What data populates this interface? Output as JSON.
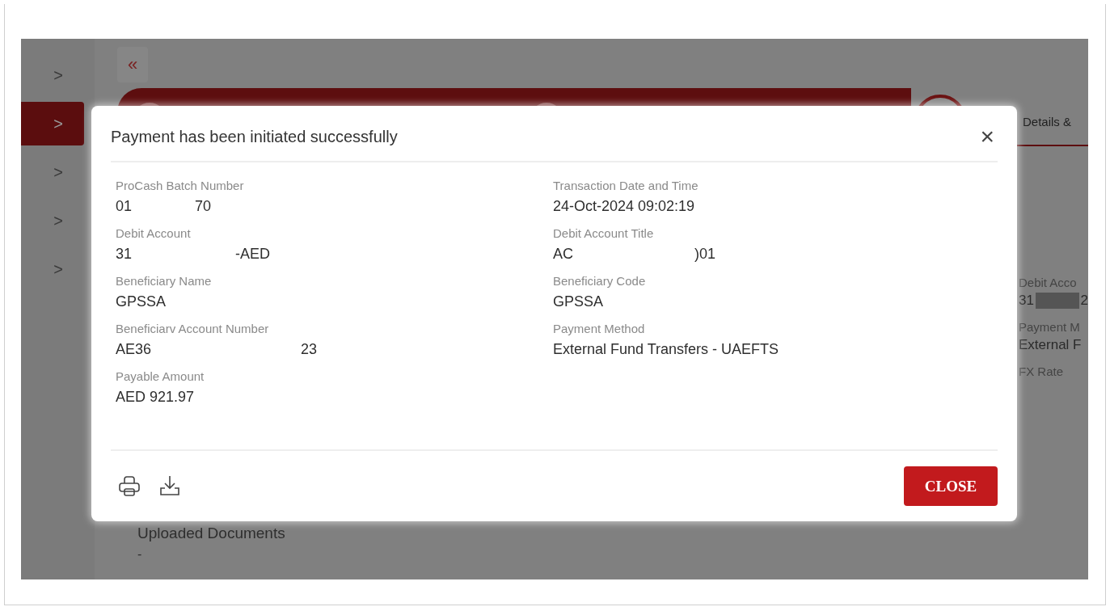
{
  "sidebar": {
    "items": [
      {
        "icon": ">",
        "selected": false
      },
      {
        "icon": ">",
        "selected": true
      },
      {
        "icon": ">",
        "selected": false
      },
      {
        "icon": ">",
        "selected": false
      },
      {
        "icon": ">",
        "selected": false
      }
    ]
  },
  "collapse_button": {
    "icon": "«"
  },
  "stepper": {
    "steps": [
      {
        "current": false
      },
      {
        "current": false
      },
      {
        "label": "Details &",
        "current": true
      }
    ]
  },
  "summary_panel": {
    "fields": [
      {
        "label": "Debit Acco",
        "value_parts": [
          "31",
          "2"
        ]
      },
      {
        "label": "Payment M",
        "value_parts": [
          "External F"
        ]
      },
      {
        "label": "FX Rate"
      }
    ]
  },
  "uploaded_documents": {
    "label": "Uploaded Documents",
    "value": "-"
  },
  "dialog": {
    "title": "Payment has been initiated successfully",
    "close_icon": "×",
    "fields": [
      {
        "label": "ProCash Batch Number",
        "value_parts": [
          "01",
          "70"
        ]
      },
      {
        "label": "Transaction Date and Time",
        "value_parts": [
          "24-Oct-2024 09:02:19"
        ]
      },
      {
        "label": "Debit Account",
        "value_parts": [
          "31",
          "-AED"
        ]
      },
      {
        "label": "Debit Account Title",
        "value_parts": [
          "AC",
          ")01"
        ]
      },
      {
        "label": "Beneficiary Name",
        "value_parts": [
          "GPSSA"
        ]
      },
      {
        "label": "Beneficiary Code",
        "value_parts": [
          "GPSSA"
        ]
      },
      {
        "label": "Beneficiarv Account Number",
        "value_parts": [
          "AE36",
          "23"
        ]
      },
      {
        "label": "Payment Method",
        "value_parts": [
          "External Fund Transfers - UAEFTS"
        ]
      },
      {
        "label": "Payable Amount",
        "value_parts": [
          "AED 921.97"
        ]
      }
    ],
    "actions": [
      {
        "kind": "print"
      },
      {
        "kind": "download"
      }
    ],
    "close_button": "CLOSE"
  }
}
